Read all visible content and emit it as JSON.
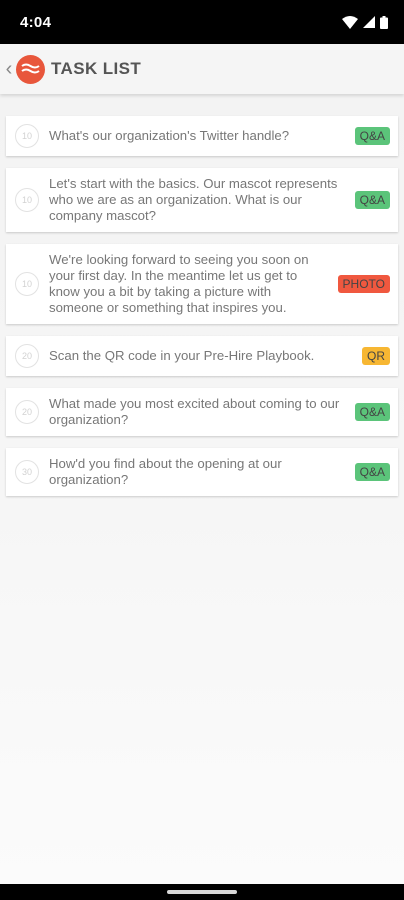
{
  "status_bar": {
    "time": "4:04",
    "icons": [
      "wifi-icon",
      "signal-icon",
      "battery-icon"
    ]
  },
  "app_bar": {
    "back_icon": "chevron-left-icon",
    "logo_icon": "app-logo-icon",
    "title": "TASK LIST"
  },
  "colors": {
    "qa": "#5bc47a",
    "photo": "#f0583f",
    "qr": "#f7b733",
    "logo": "#e8563b"
  },
  "tasks": [
    {
      "points": "10",
      "text": "What's our organization's Twitter handle?",
      "badge": "Q&A",
      "badge_type": "qa"
    },
    {
      "points": "10",
      "text": "Let's start with the basics. Our mascot represents who we are as an organization. What is our company mascot?",
      "badge": "Q&A",
      "badge_type": "qa"
    },
    {
      "points": "10",
      "text": "We're looking forward to seeing you soon on your first day. In the meantime let us get to know you a bit by taking a picture with someone or something that inspires you.",
      "badge": "PHOTO",
      "badge_type": "photo"
    },
    {
      "points": "20",
      "text": "Scan the QR code in your Pre-Hire Playbook.",
      "badge": "QR",
      "badge_type": "qr"
    },
    {
      "points": "20",
      "text": "What made you most excited about coming to our organization?",
      "badge": "Q&A",
      "badge_type": "qa"
    },
    {
      "points": "30",
      "text": "How'd you find about the opening at our organization?",
      "badge": "Q&A",
      "badge_type": "qa"
    }
  ]
}
